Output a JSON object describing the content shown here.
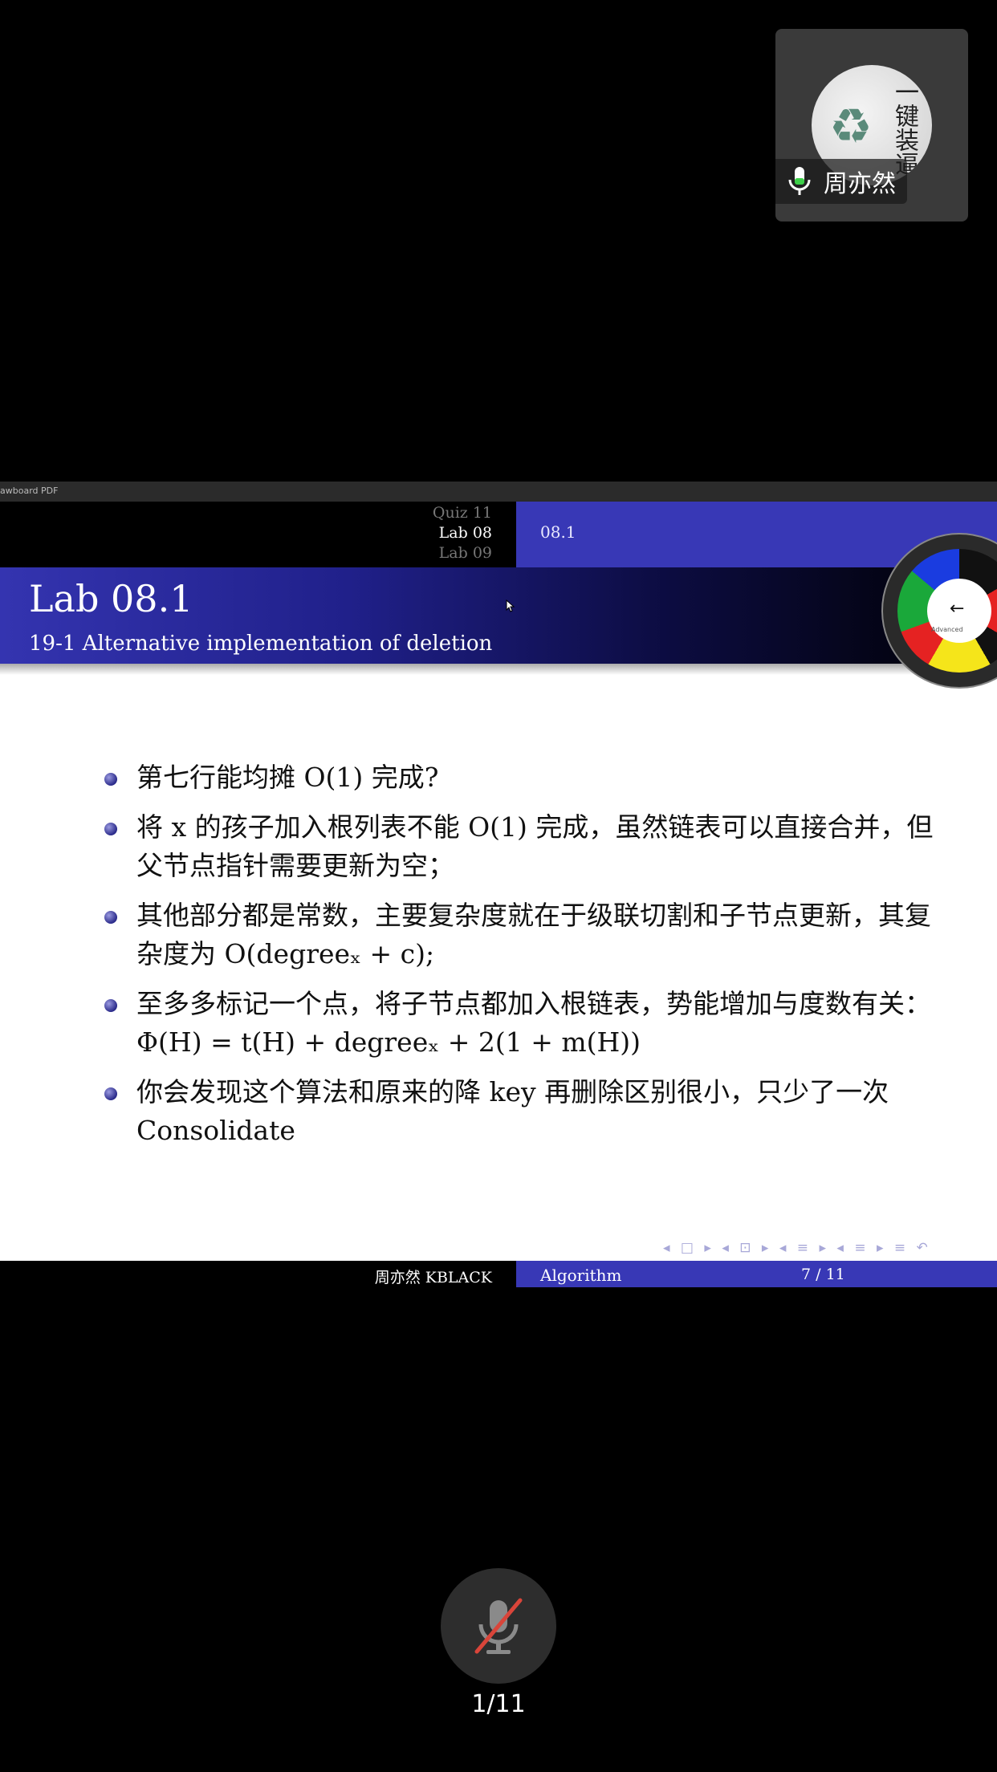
{
  "participant": {
    "name": "周亦然",
    "avatar_text": "一键装逼",
    "avatar_icon": "recycle-icon",
    "mic_icon": "microphone-icon"
  },
  "window": {
    "title": "awboard PDF"
  },
  "slide": {
    "nav_sections": [
      "Quiz 11",
      "Lab 08",
      "Lab 09"
    ],
    "nav_subsection": "08.1",
    "frame_title": "Lab 08.1",
    "frame_subtitle": "19-1 Alternative implementation of deletion",
    "bullets": [
      "第七行能均摊 O(1) 完成?",
      "将 x 的孩子加入根列表不能 O(1) 完成，虽然链表可以直接合并，但父节点指针需要更新为空；",
      "其他部分都是常数，主要复杂度就在于级联切割和子节点更新，其复杂度为 O(degreeₓ + c);",
      "至多多标记一个点，将子节点都加入根链表，势能增加与度数有关：Φ(H) = t(H) + degreeₓ + 2(1 + m(H))",
      "你会发现这个算法和原来的降 key 再删除区别很小，只少了一次 Consolidate"
    ],
    "nav_symbols": "◂ □ ▸ ◂ ⊡ ▸ ◂ ≡ ▸ ◂ ≡ ▸ ≡ ↶",
    "footer_author": "周亦然 KBLACK",
    "footer_title": "Algorithm",
    "footer_page": "7 / 11"
  },
  "pen_tool": {
    "center_arrow": "←",
    "label": "Advanced",
    "colors": [
      "#111111",
      "#e52222",
      "#f5e51a",
      "#1aa83a",
      "#1a3ce0"
    ]
  },
  "controls": {
    "mute_icon": "microphone-muted-icon",
    "page_indicator": "1/11"
  },
  "colors": {
    "beamer_blue": "#3838b6",
    "muted_red": "#d9453a"
  }
}
